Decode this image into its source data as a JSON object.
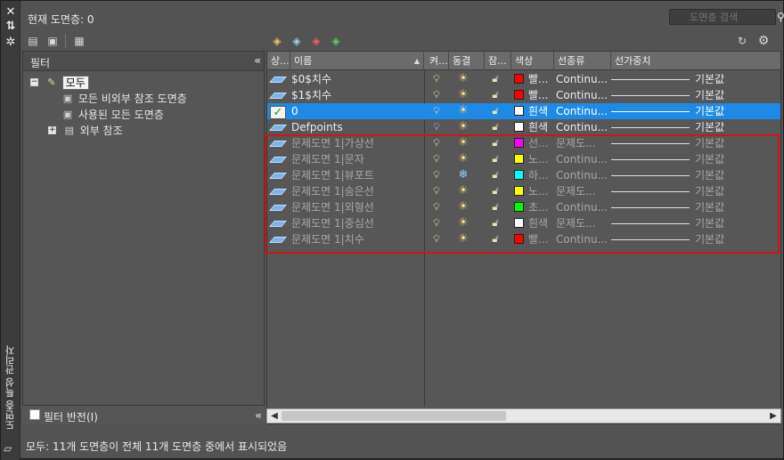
{
  "sidebar": {
    "title": "도면층 특성 관리자"
  },
  "header": {
    "current_layer": "현재 도면층: 0",
    "search_placeholder": "도면층 검색"
  },
  "filter_pane": {
    "title": "필터",
    "tree": [
      {
        "label": "모두",
        "level": 0,
        "selected": true
      },
      {
        "label": "모든 비외부 참조 도면층",
        "level": 1
      },
      {
        "label": "사용된 모든 도면층",
        "level": 1
      },
      {
        "label": "외부 참조",
        "level": 1
      }
    ],
    "invert_label": "필터 반전(I)"
  },
  "grid": {
    "headers": [
      "상...",
      "이름",
      "켜...",
      "동결",
      "잠...",
      "색상",
      "선종류",
      "선가중치"
    ],
    "rows": [
      {
        "name": "$0$치수",
        "color_name": "빨...",
        "color": "#ff0000",
        "linetype": "Continu...",
        "lineweight": "기본값"
      },
      {
        "name": "$1$치수",
        "color_name": "빨...",
        "color": "#ff0000",
        "linetype": "Continu...",
        "lineweight": "기본값"
      },
      {
        "name": "0",
        "color_name": "흰색",
        "color": "#ffffff",
        "linetype": "Continu...",
        "lineweight": "기본값"
      },
      {
        "name": "Defpoints",
        "color_name": "흰색",
        "color": "#ffffff",
        "linetype": "Continu...",
        "lineweight": "기본값"
      },
      {
        "name": "문제도면 1|가상선",
        "color_name": "선...",
        "color": "#ff00ff",
        "linetype": "문제도...",
        "lineweight": "기본값"
      },
      {
        "name": "문제도면 1|문자",
        "color_name": "노...",
        "color": "#ffff00",
        "linetype": "Continu...",
        "lineweight": "기본값"
      },
      {
        "name": "문제도면 1|뷰포트",
        "color_name": "하...",
        "color": "#00ffff",
        "linetype": "Continu...",
        "lineweight": "기본값"
      },
      {
        "name": "문제도면 1|숨은선",
        "color_name": "노...",
        "color": "#ffff00",
        "linetype": "문제도...",
        "lineweight": "기본값"
      },
      {
        "name": "문제도면 1|외형선",
        "color_name": "초...",
        "color": "#00ff00",
        "linetype": "Continu...",
        "lineweight": "기본값"
      },
      {
        "name": "문제도면 1|중심선",
        "color_name": "흰색",
        "color": "#ffffff",
        "linetype": "문제도...",
        "lineweight": "기본값"
      },
      {
        "name": "문제도면 1|치수",
        "color_name": "빨...",
        "color": "#ff0000",
        "linetype": "Continu...",
        "lineweight": "기본값"
      }
    ]
  },
  "status": {
    "text": "모두: 11개 도면층이 전체 11개 도면층 중에서 표시되었음"
  }
}
